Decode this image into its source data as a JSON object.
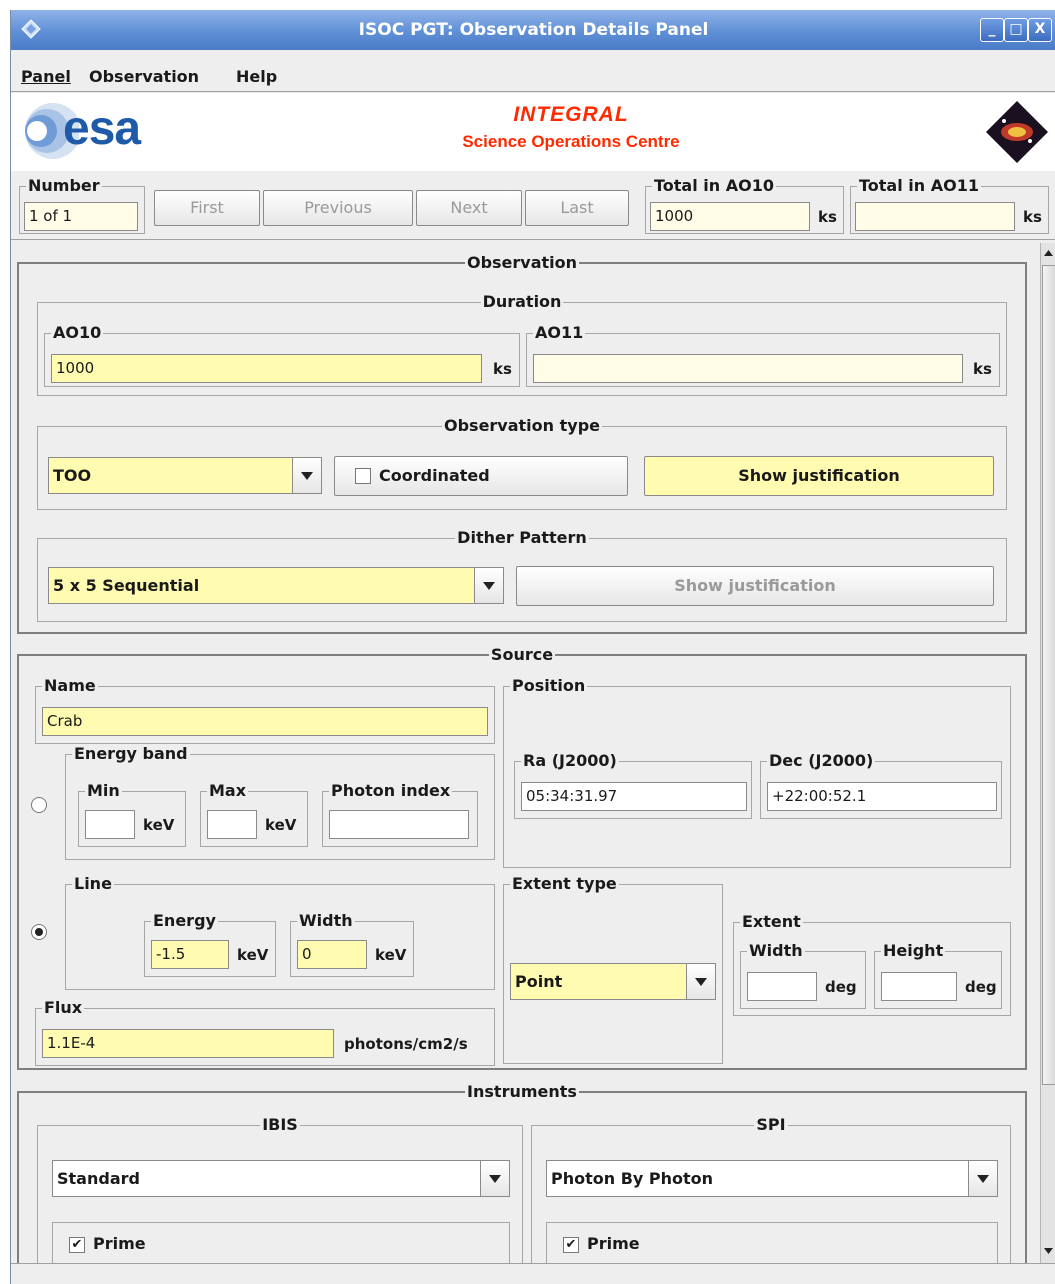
{
  "window": {
    "title": "ISOC PGT: Observation Details Panel",
    "controls": [
      "_",
      "□",
      "X"
    ]
  },
  "menu": {
    "items": [
      "Panel",
      "Observation",
      "Help"
    ]
  },
  "banner": {
    "esa_logo": "esa",
    "mission": "INTEGRAL",
    "centre": "Science Operations Centre"
  },
  "toolbar": {
    "number_label": "Number",
    "number_value": "1 of 1",
    "first": "First",
    "previous": "Previous",
    "next": "Next",
    "last": "Last",
    "total_ao10_label": "Total in AO10",
    "total_ao10_value": "1000",
    "total_ao10_unit": "ks",
    "total_ao11_label": "Total in AO11",
    "total_ao11_value": "",
    "total_ao11_unit": "ks"
  },
  "observation": {
    "title": "Observation",
    "duration": {
      "title": "Duration",
      "ao10_label": "AO10",
      "ao10_value": "1000",
      "ao10_unit": "ks",
      "ao11_label": "AO11",
      "ao11_value": "",
      "ao11_unit": "ks"
    },
    "type": {
      "title": "Observation type",
      "selected": "TOO",
      "coordinated_label": "Coordinated",
      "coordinated_checked": false,
      "justification": "Show justification"
    },
    "dither": {
      "title": "Dither Pattern",
      "selected": "5 x 5 Sequential",
      "justification": "Show justification"
    }
  },
  "source": {
    "title": "Source",
    "name_label": "Name",
    "name_value": "Crab",
    "energy_band": {
      "title": "Energy band",
      "min_label": "Min",
      "min_value": "",
      "min_unit": "keV",
      "max_label": "Max",
      "max_value": "",
      "max_unit": "keV",
      "index_label": "Photon index",
      "index_value": ""
    },
    "line": {
      "title": "Line",
      "energy_label": "Energy",
      "energy_value": "-1.5",
      "energy_unit": "keV",
      "width_label": "Width",
      "width_value": "0",
      "width_unit": "keV"
    },
    "flux": {
      "label": "Flux",
      "value": "1.1E-4",
      "unit": "photons/cm2/s"
    },
    "position": {
      "title": "Position",
      "ra_label": "Ra (J2000)",
      "ra_value": "05:34:31.97",
      "dec_label": "Dec (J2000)",
      "dec_value": "+22:00:52.1"
    },
    "extent_type": {
      "title": "Extent type",
      "selected": "Point"
    },
    "extent": {
      "title": "Extent",
      "width_label": "Width",
      "width_value": "",
      "width_unit": "deg",
      "height_label": "Height",
      "height_value": "",
      "height_unit": "deg"
    }
  },
  "instruments": {
    "title": "Instruments",
    "ibis": {
      "title": "IBIS",
      "selected": "Standard",
      "prime_label": "Prime",
      "prime_checked": true
    },
    "spi": {
      "title": "SPI",
      "selected": "Photon By Photon",
      "prime_label": "Prime",
      "prime_checked": true
    }
  },
  "colors": {
    "titlebar": "#5f8fd6",
    "field_yellow": "#fffbb0",
    "banner_red": "#ff2a00",
    "esa_blue": "#1e5aa8"
  }
}
